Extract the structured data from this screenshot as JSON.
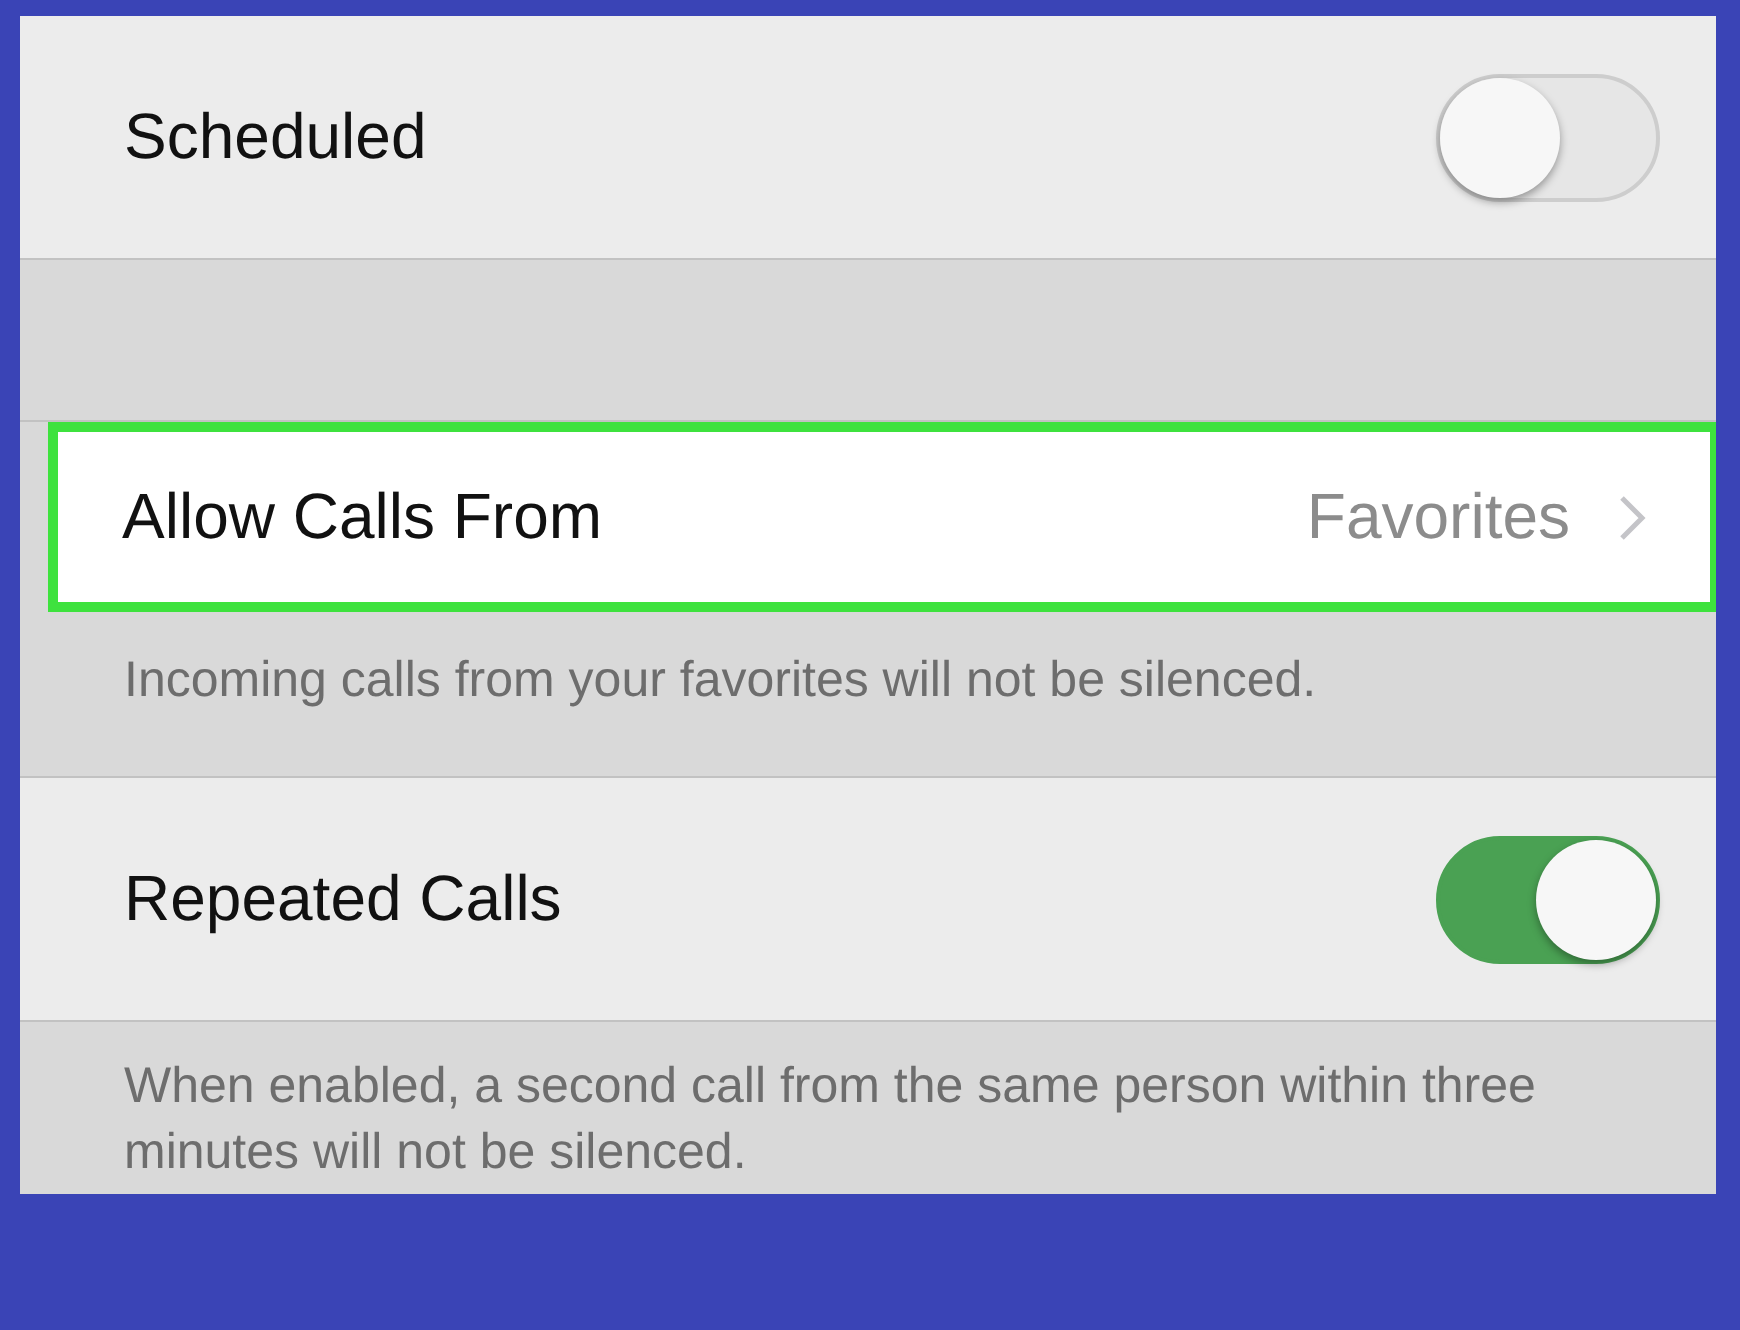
{
  "sections": [
    {
      "rows": [
        {
          "kind": "toggle",
          "label": "Scheduled",
          "on": false
        }
      ]
    },
    {
      "rows": [
        {
          "kind": "link",
          "label": "Allow Calls From",
          "value": "Favorites",
          "highlighted": true
        }
      ],
      "footer": "Incoming calls from your favorites will not be silenced."
    },
    {
      "rows": [
        {
          "kind": "toggle",
          "label": "Repeated Calls",
          "on": true
        }
      ],
      "footer": "When enabled, a second call from the same person within three minutes will not be silenced."
    }
  ]
}
